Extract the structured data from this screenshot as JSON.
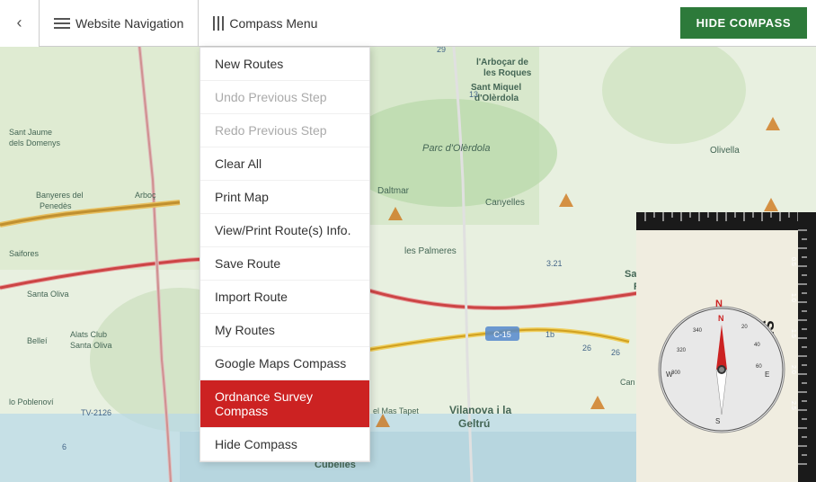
{
  "navbar": {
    "back_label": "‹",
    "website_nav_label": "Website Navigation",
    "compass_menu_label": "Compass Menu",
    "hide_compass_label": "HIDE COMPASS"
  },
  "menu": {
    "items": [
      {
        "id": "new-routes",
        "label": "New Routes",
        "state": "normal"
      },
      {
        "id": "undo-previous-step",
        "label": "Undo Previous Step",
        "state": "disabled"
      },
      {
        "id": "redo-previous-step",
        "label": "Redo Previous Step",
        "state": "disabled"
      },
      {
        "id": "clear-all",
        "label": "Clear All",
        "state": "normal"
      },
      {
        "id": "print-map",
        "label": "Print Map",
        "state": "normal"
      },
      {
        "id": "view-print-route-info",
        "label": "View/Print Route(s) Info.",
        "state": "normal"
      },
      {
        "id": "save-route",
        "label": "Save Route",
        "state": "normal"
      },
      {
        "id": "import-route",
        "label": "Import Route",
        "state": "normal"
      },
      {
        "id": "my-routes",
        "label": "My Routes",
        "state": "normal"
      },
      {
        "id": "google-maps-compass",
        "label": "Google Maps Compass",
        "state": "normal"
      },
      {
        "id": "ordnance-survey-compass",
        "label": "Ordnance Survey Compass",
        "state": "active"
      },
      {
        "id": "hide-compass",
        "label": "Hide Compass",
        "state": "normal"
      }
    ]
  },
  "map": {
    "accent_color": "#cc2222",
    "road_color": "#e8c0c0",
    "bg_color": "#e8f0e0"
  }
}
